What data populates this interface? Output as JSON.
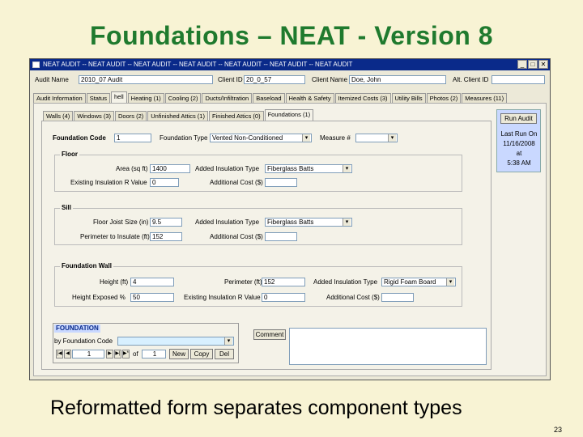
{
  "slide": {
    "title": "Foundations – NEAT - Version 8",
    "caption": "Reformatted form separates component types",
    "page_number": "23"
  },
  "window": {
    "title": "NEAT AUDIT  --  NEAT AUDIT  --  NEAT AUDIT  --  NEAT AUDIT  --  NEAT AUDIT  --  NEAT AUDIT  --  NEAT AUDIT",
    "minimize": "_",
    "maximize": "□",
    "close": "✕"
  },
  "header": {
    "audit_name_label": "Audit Name",
    "audit_name_value": "2010_07 Audit",
    "client_id_label": "Client ID",
    "client_id_value": "20_0_57",
    "client_name_label": "Client Name",
    "client_name_value": "Doe, John",
    "alt_client_id_label": "Alt. Client ID",
    "alt_client_id_value": ""
  },
  "main_tabs": [
    "Audit Information",
    "Status",
    "hell",
    "Heating (1)",
    "Cooling (2)",
    "Ducts/Infiltration",
    "Baseload",
    "Health & Safety",
    "Itemized Costs (3)",
    "Utility Bills",
    "Photos (2)",
    "Measures (11)"
  ],
  "sub_tabs": [
    "Walls (4)",
    "Windows (3)",
    "Doors (2)",
    "Unfinished Attics (1)",
    "Finished Attics (0)",
    "Foundations (1)"
  ],
  "foundation": {
    "code_label": "Foundation Code",
    "code_value": "1",
    "type_label": "Foundation Type",
    "type_value": "Vented Non-Conditioned",
    "measure_label": "Measure #",
    "measure_value": ""
  },
  "floor": {
    "title": "Floor",
    "area_label": "Area (sq ft)",
    "area_value": "1400",
    "added_ins_type_label": "Added Insulation Type",
    "added_ins_type_value": "Fiberglass Batts",
    "existing_r_label": "Existing Insulation R Value",
    "existing_r_value": "0",
    "add_cost_label": "Additional Cost ($)",
    "add_cost_value": ""
  },
  "sill": {
    "title": "Sill",
    "joist_size_label": "Floor Joist Size (in)",
    "joist_size_value": "9.5",
    "added_ins_type_label": "Added Insulation Type",
    "added_ins_type_value": "Fiberglass Batts",
    "perimeter_label": "Perimeter to Insulate (ft)",
    "perimeter_value": "152",
    "add_cost_label": "Additional Cost ($)",
    "add_cost_value": ""
  },
  "wall": {
    "title": "Foundation Wall",
    "height_label": "Height (ft)",
    "height_value": "4",
    "perimeter_label": "Perimeter (ft)",
    "perimeter_value": "152",
    "added_ins_type_label": "Added Insulation Type",
    "added_ins_type_value": "Rigid Foam Board",
    "exposed_label": "Height Exposed %",
    "exposed_value": "50",
    "existing_r_label": "Existing Insulation R Value",
    "existing_r_value": "0",
    "add_cost_label": "Additional Cost ($)",
    "add_cost_value": ""
  },
  "nav": {
    "header": "FOUNDATION",
    "sort_label": "by Foundation Code",
    "sort_value": "",
    "record_current": "1",
    "of_label": "of",
    "record_total": "1",
    "new_label": "New",
    "copy_label": "Copy",
    "delete_label": "Del"
  },
  "comment_button": "Comment",
  "side": {
    "run_audit": "Run Audit",
    "last_run_label": "Last Run On",
    "last_run_date": "11/16/2008",
    "at_label": "at",
    "last_run_time": "5:38 AM"
  }
}
